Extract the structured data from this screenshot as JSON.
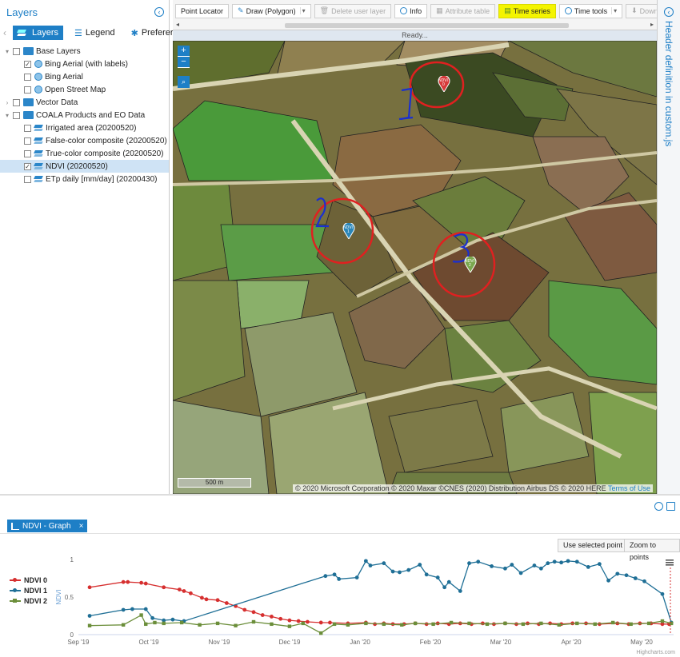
{
  "left_panel": {
    "title": "Layers",
    "tabs": [
      {
        "label": "Layers",
        "active": true
      },
      {
        "label": "Legend",
        "active": false
      },
      {
        "label": "Preferer",
        "active": false
      }
    ],
    "tree": [
      {
        "label": "Base Layers",
        "type": "folder",
        "expanded": true,
        "level": 0,
        "checked": false
      },
      {
        "label": "Bing Aerial (with labels)",
        "type": "globe",
        "level": 1,
        "checked": true
      },
      {
        "label": "Bing Aerial",
        "type": "globe",
        "level": 1,
        "checked": false
      },
      {
        "label": "Open Street Map",
        "type": "globe",
        "level": 1,
        "checked": false
      },
      {
        "label": "Vector Data",
        "type": "folder",
        "expanded": false,
        "level": 0,
        "checked": false
      },
      {
        "label": "COALA Products and EO Data",
        "type": "folder",
        "expanded": true,
        "level": 0,
        "checked": false
      },
      {
        "label": "Irrigated area (20200520)",
        "type": "layer",
        "level": 1,
        "checked": false
      },
      {
        "label": "False-color composite (20200520)",
        "type": "layer",
        "level": 1,
        "checked": false
      },
      {
        "label": "True-color composite (20200520)",
        "type": "layer",
        "level": 1,
        "checked": false
      },
      {
        "label": "NDVI (20200520)",
        "type": "layer",
        "level": 1,
        "checked": true,
        "selected": true
      },
      {
        "label": "ETp daily [mm/day] (20200430)",
        "type": "layer",
        "level": 1,
        "checked": false
      }
    ]
  },
  "toolbar": {
    "point_locator": "Point Locator",
    "draw": "Draw (Polygon)",
    "delete": "Delete user layer",
    "info": "Info",
    "attribute_table": "Attribute table",
    "time_series": "Time series",
    "time_tools": "Time tools",
    "download": "Download"
  },
  "status": "Ready...",
  "map": {
    "zoom_in": "+",
    "zoom_out": "−",
    "scale": "500 m",
    "attribution": "© 2020 Microsoft Corporation © 2020 Maxar ©CNES (2020) Distribution Airbus DS © 2020 HERE",
    "terms": "Terms of Use",
    "markers": [
      {
        "label": "NDVI",
        "sub": "0",
        "color": "#d63a3a"
      },
      {
        "label": "NDVI",
        "sub": "1",
        "color": "#2a86b8"
      },
      {
        "label": "NDVI",
        "sub": "2",
        "color": "#7aa84e"
      }
    ]
  },
  "right_panel": {
    "title": "Header definition in custom.js"
  },
  "graph": {
    "tab_label": "NDVI - Graph",
    "close": "×",
    "use_selected": "Use selected point",
    "zoom_to_points": "Zoom to points",
    "credit": "Highcharts.com"
  },
  "chart_data": {
    "type": "line",
    "ylabel": "NDVI",
    "ylim": [
      0,
      1
    ],
    "yticks": [
      "0",
      "0.5",
      "1"
    ],
    "xticks": [
      "Sep '19",
      "Oct '19",
      "Nov '19",
      "Dec '19",
      "Jan '20",
      "Feb '20",
      "Mar '20",
      "Apr '20",
      "May '20"
    ],
    "xlim": [
      0,
      265
    ],
    "series": [
      {
        "name": "NDVI 0",
        "color": "#d62f2f",
        "marker": "circle",
        "x": [
          5,
          20,
          22,
          28,
          30,
          38,
          45,
          47,
          50,
          55,
          57,
          62,
          66,
          70,
          74,
          78,
          82,
          86,
          90,
          94,
          98,
          102,
          108,
          112,
          120,
          128,
          132,
          136,
          140,
          145,
          150,
          155,
          160,
          165,
          170,
          175,
          180,
          185,
          190,
          195,
          200,
          205,
          210,
          215,
          220,
          226,
          232,
          240,
          245,
          250,
          255,
          260,
          263
        ],
        "y": [
          0.63,
          0.7,
          0.7,
          0.69,
          0.68,
          0.63,
          0.6,
          0.58,
          0.55,
          0.49,
          0.47,
          0.46,
          0.42,
          0.38,
          0.33,
          0.3,
          0.26,
          0.24,
          0.21,
          0.19,
          0.18,
          0.17,
          0.16,
          0.16,
          0.15,
          0.16,
          0.14,
          0.15,
          0.14,
          0.14,
          0.15,
          0.14,
          0.15,
          0.14,
          0.15,
          0.14,
          0.15,
          0.14,
          0.15,
          0.14,
          0.15,
          0.14,
          0.15,
          0.14,
          0.15,
          0.15,
          0.14,
          0.15,
          0.14,
          0.15,
          0.15,
          0.14,
          0.14
        ]
      },
      {
        "name": "NDVI 1",
        "color": "#1f6f96",
        "marker": "circle",
        "x": [
          5,
          20,
          24,
          30,
          33,
          38,
          42,
          47,
          110,
          114,
          116,
          124,
          128,
          130,
          136,
          140,
          143,
          147,
          152,
          155,
          160,
          163,
          165,
          170,
          174,
          178,
          184,
          190,
          193,
          197,
          203,
          206,
          209,
          212,
          215,
          218,
          222,
          227,
          232,
          236,
          240,
          244,
          248,
          252,
          260,
          264
        ],
        "y": [
          0.25,
          0.33,
          0.34,
          0.34,
          0.22,
          0.19,
          0.2,
          0.18,
          0.78,
          0.8,
          0.74,
          0.76,
          0.98,
          0.92,
          0.95,
          0.84,
          0.83,
          0.86,
          0.93,
          0.8,
          0.76,
          0.63,
          0.7,
          0.58,
          0.95,
          0.97,
          0.91,
          0.88,
          0.93,
          0.82,
          0.92,
          0.88,
          0.95,
          0.97,
          0.96,
          0.98,
          0.97,
          0.9,
          0.94,
          0.72,
          0.81,
          0.79,
          0.75,
          0.71,
          0.54,
          0.16
        ]
      },
      {
        "name": "NDVI 2",
        "color": "#6b8e3a",
        "marker": "square",
        "x": [
          5,
          20,
          28,
          30,
          34,
          38,
          46,
          54,
          62,
          70,
          78,
          86,
          94,
          100,
          108,
          114,
          120,
          128,
          136,
          144,
          150,
          158,
          166,
          174,
          182,
          190,
          198,
          206,
          214,
          222,
          230,
          238,
          246,
          254,
          260,
          264
        ],
        "y": [
          0.12,
          0.13,
          0.26,
          0.14,
          0.16,
          0.15,
          0.16,
          0.13,
          0.15,
          0.12,
          0.17,
          0.14,
          0.11,
          0.15,
          0.02,
          0.14,
          0.13,
          0.15,
          0.14,
          0.13,
          0.15,
          0.14,
          0.16,
          0.15,
          0.14,
          0.15,
          0.14,
          0.15,
          0.13,
          0.15,
          0.14,
          0.16,
          0.14,
          0.15,
          0.18,
          0.15
        ]
      }
    ],
    "grid": false,
    "legend": "left"
  }
}
